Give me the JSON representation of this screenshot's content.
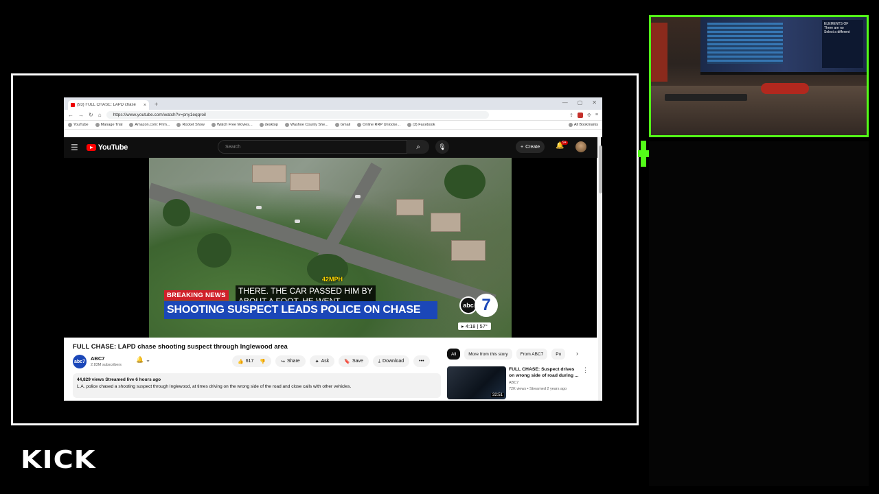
{
  "browser": {
    "tab_title": "(93) FULL CHASE: LAPD chase",
    "tab_close": "×",
    "new_tab": "+",
    "window_controls": [
      "—",
      "▢",
      "✕"
    ],
    "url": "https://www.youtube.com/watch?v=pny1eqqroil",
    "bookmarks": [
      "YouTube",
      "Manage Trial",
      "Amazon.com: Prim...",
      "Rocket Show",
      "Watch Free Movies...",
      "desktop",
      "Washoe County She...",
      "Gmail",
      "Online RRP Unlocke...",
      "(3) Facebook"
    ],
    "all_bookmarks": "All Bookmarks"
  },
  "youtube": {
    "logo_text": "YouTube",
    "search_placeholder": "Search",
    "create_label": "Create",
    "notif_badge": "9+"
  },
  "video": {
    "speed": "42MPH",
    "caption_line1": "THERE. THE CAR PASSED HIM BY",
    "caption_line2": "ABOUT A FOOT. HE WENT",
    "breaking": "BREAKING NEWS",
    "headline": "SHOOTING SUSPECT LEADS POLICE ON CHASE",
    "station_abc": "abc",
    "station_num": "7",
    "time_temp": "▸ 4:18 | 57°"
  },
  "info": {
    "title": "FULL CHASE: LAPD chase shooting suspect through Inglewood area",
    "channel_avatar": "abc7",
    "channel": "ABC7",
    "subscribers": "2.83M subscribers",
    "likes": "617",
    "share": "Share",
    "ask": "Ask",
    "save": "Save",
    "download": "Download",
    "more": "•••",
    "stats": "44,829 views  Streamed live 6 hours ago",
    "description": "L.A. police chased a shooting suspect through Inglewood, at times driving on the wrong side of the road and close calls with other vehicles."
  },
  "sidebar": {
    "chips": [
      "All",
      "More from this story",
      "From ABC7",
      "Po"
    ],
    "rec_title": "FULL CHASE: Suspect drives on wrong side of road during ...",
    "rec_channel": "ABC7",
    "rec_meta": "72K views • Streamed 2 years ago",
    "rec_duration": "32:51",
    "rec_more": "⋮"
  },
  "webcam": {
    "panel_line1": "ELEMENTS OF",
    "panel_line2": "There are no",
    "panel_line3": "Select a different"
  },
  "brand": {
    "kick_logo": "KICK",
    "accent": "#53fc18"
  }
}
